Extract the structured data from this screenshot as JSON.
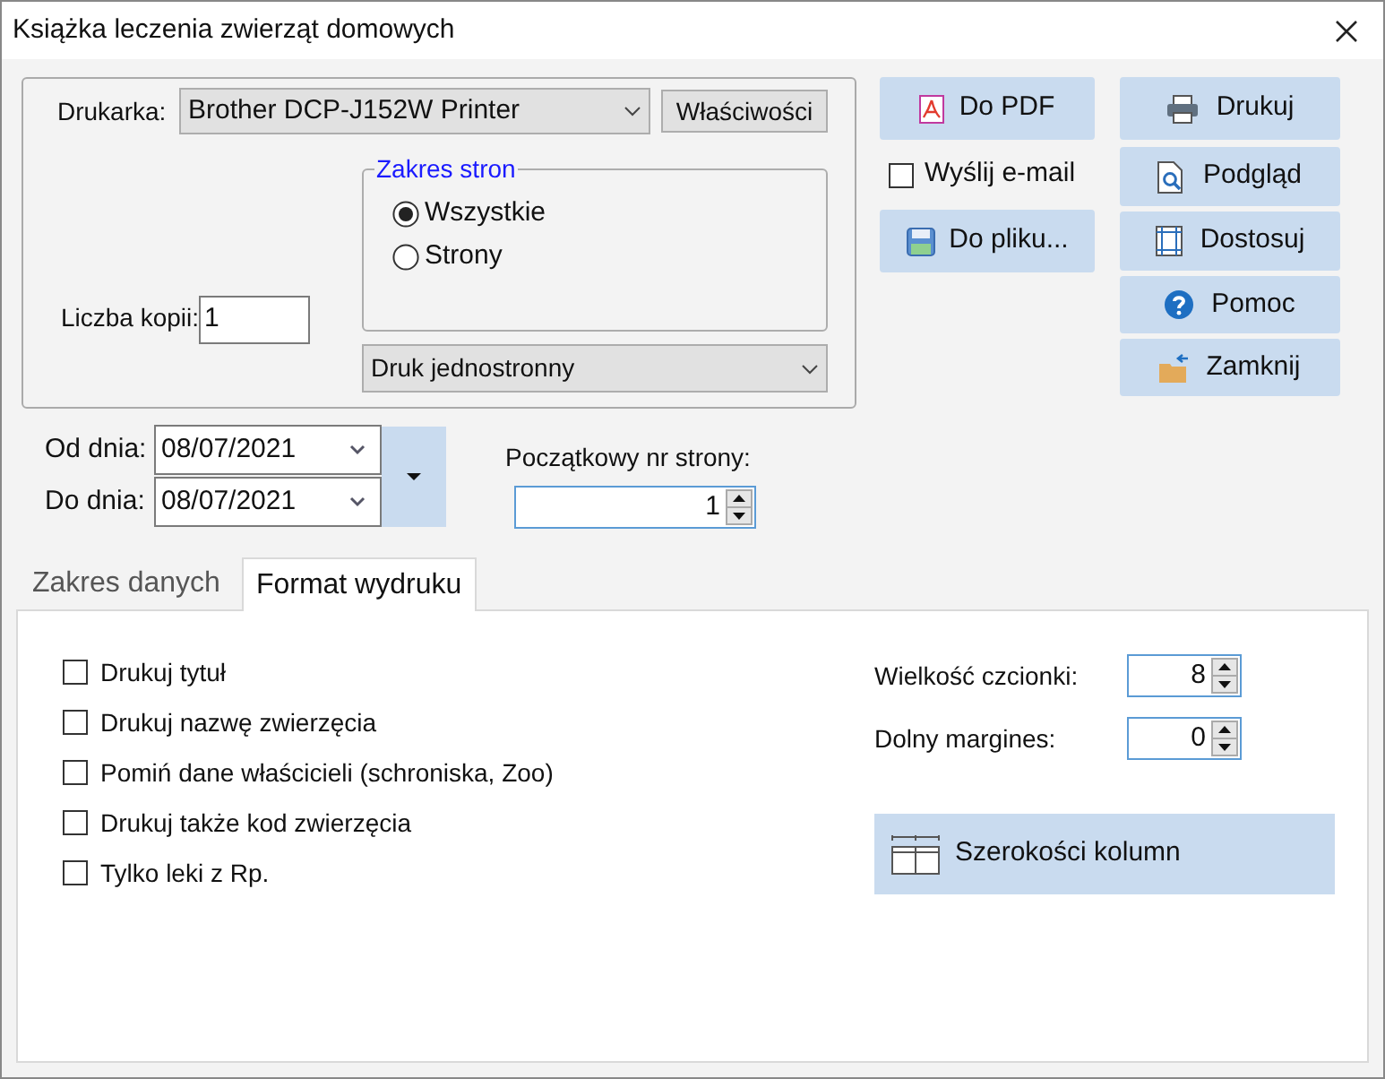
{
  "window": {
    "title": "Książka leczenia zwierząt domowych"
  },
  "printer": {
    "label": "Drukarka:",
    "value": "Brother DCP-J152W Printer",
    "properties_button": "Właściwości"
  },
  "copies": {
    "label": "Liczba kopii:",
    "value": "1"
  },
  "page_range": {
    "title": "Zakres stron",
    "options": [
      {
        "label": "Wszystkie",
        "selected": true
      },
      {
        "label": "Strony",
        "selected": false
      }
    ]
  },
  "duplex": {
    "value": "Druk jednostronny"
  },
  "actions_left": [
    {
      "kind": "button",
      "label": "Do PDF"
    },
    {
      "kind": "checkbox",
      "label": "Wyślij e-mail",
      "checked": false
    },
    {
      "kind": "button",
      "label": "Do pliku..."
    }
  ],
  "actions_right": [
    {
      "label": "Drukuj"
    },
    {
      "label": "Podgląd"
    },
    {
      "label": "Dostosuj"
    },
    {
      "label": "Pomoc"
    },
    {
      "label": "Zamknij"
    }
  ],
  "dates": [
    {
      "label": "Od dnia:",
      "value": "08/07/2021"
    },
    {
      "label": "Do dnia:",
      "value": "08/07/2021"
    }
  ],
  "start_page": {
    "label": "Początkowy nr strony:",
    "value": "1"
  },
  "tabs": [
    {
      "label": "Zakres danych",
      "selected": false
    },
    {
      "label": "Format wydruku",
      "selected": true
    }
  ],
  "options": [
    {
      "label": "Drukuj tytuł",
      "checked": false
    },
    {
      "label": "Drukuj nazwę zwierzęcia",
      "checked": false
    },
    {
      "label": "Pomiń dane właścicieli (schroniska, Zoo)",
      "checked": false
    },
    {
      "label": "Drukuj także kod zwierzęcia",
      "checked": false
    },
    {
      "label": "Tylko leki z Rp.",
      "checked": false
    }
  ],
  "settings": [
    {
      "label": "Wielkość czcionki:",
      "value": "8"
    },
    {
      "label": "Dolny margines:",
      "value": "0"
    }
  ],
  "column_widths_button": "Szerokości kolumn"
}
